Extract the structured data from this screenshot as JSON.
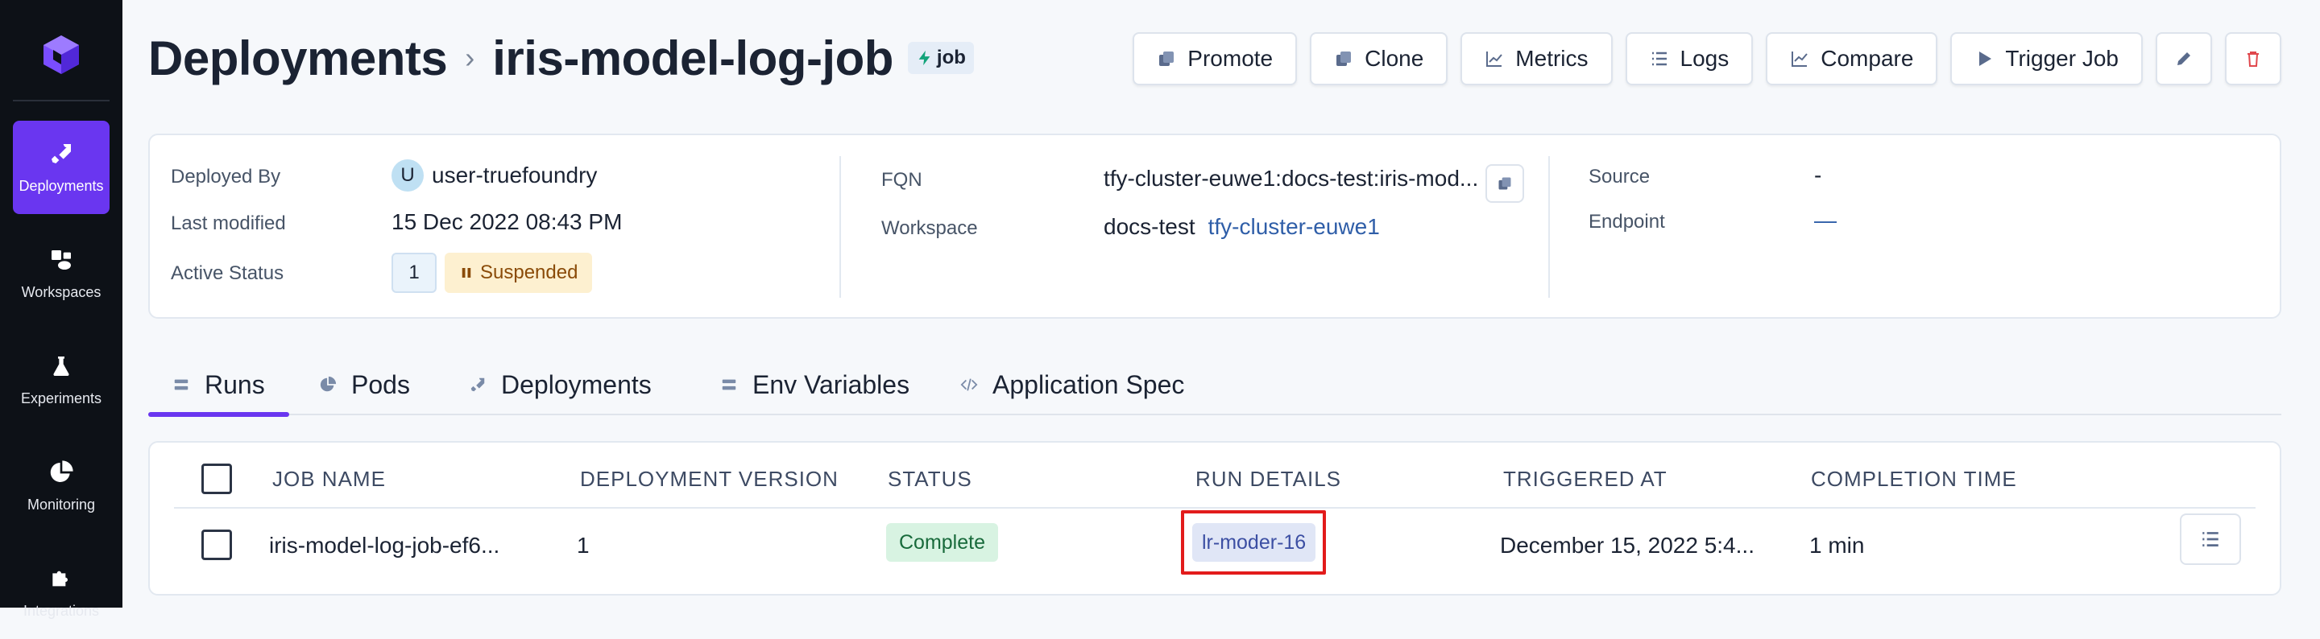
{
  "sidebar": {
    "items": [
      {
        "label": "Deployments",
        "active": true
      },
      {
        "label": "Workspaces"
      },
      {
        "label": "Experiments"
      },
      {
        "label": "Monitoring"
      },
      {
        "label": "Integrations"
      }
    ]
  },
  "header": {
    "breadcrumb_root": "Deployments",
    "breadcrumb_sep": "›",
    "title": "iris-model-log-job",
    "badge": "job"
  },
  "actions": {
    "promote": "Promote",
    "clone": "Clone",
    "metrics": "Metrics",
    "logs": "Logs",
    "compare": "Compare",
    "trigger": "Trigger Job"
  },
  "info": {
    "deployed_by_label": "Deployed By",
    "deployed_by_avatar": "U",
    "deployed_by": "user-truefoundry",
    "last_modified_label": "Last modified",
    "last_modified": "15 Dec 2022 08:43 PM",
    "active_status_label": "Active Status",
    "active_count": "1",
    "status": "Suspended",
    "fqn_label": "FQN",
    "fqn": "tfy-cluster-euwe1:docs-test:iris-mod...",
    "workspace_label": "Workspace",
    "workspace": "docs-test",
    "cluster": "tfy-cluster-euwe1",
    "source_label": "Source",
    "source": "-",
    "endpoint_label": "Endpoint",
    "endpoint": "—"
  },
  "tabs": [
    {
      "label": "Runs",
      "active": true
    },
    {
      "label": "Pods"
    },
    {
      "label": "Deployments"
    },
    {
      "label": "Env Variables"
    },
    {
      "label": "Application Spec"
    }
  ],
  "table": {
    "columns": [
      "JOB NAME",
      "DEPLOYMENT VERSION",
      "STATUS",
      "RUN DETAILS",
      "TRIGGERED AT",
      "COMPLETION TIME"
    ],
    "rows": [
      {
        "job_name": "iris-model-log-job-ef6...",
        "deployment_version": "1",
        "status": "Complete",
        "run_details": "lr-moder-16",
        "triggered_at": "December 15, 2022 5:4...",
        "completion_time": "1 min"
      }
    ]
  },
  "colors": {
    "accent": "#6a36f0",
    "sidebar_bg": "#0d1117",
    "highlight": "#e21b1b"
  }
}
